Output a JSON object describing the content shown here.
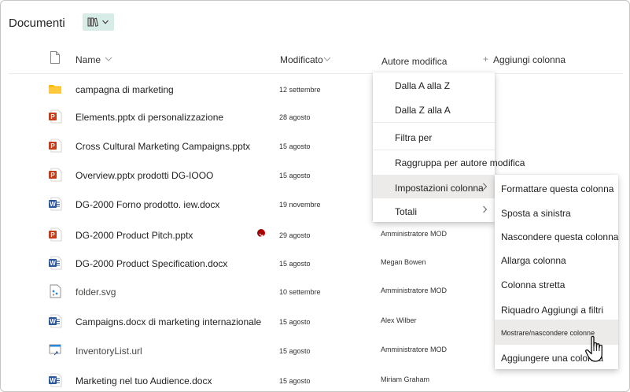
{
  "library": {
    "title": "Documenti",
    "view_icon": "library-icon"
  },
  "columns": {
    "name": "Name",
    "modified": "Modificato",
    "author": "Autore modifica",
    "add_column": "Aggiungi colonna",
    "add_symbol": "+"
  },
  "files": [
    {
      "name": "campagna di marketing",
      "date": "12 settembre",
      "author": "",
      "type": "folder"
    },
    {
      "name": "Elements.pptx di personalizzazione",
      "date": "28 agosto",
      "author": "",
      "type": "pptx"
    },
    {
      "name": "Cross Cultural Marketing Campaigns.pptx",
      "date": "15 agosto",
      "author": "",
      "type": "pptx"
    },
    {
      "name": "Overview.pptx prodotti DG-IOOO",
      "date": "15 agosto",
      "author": "",
      "type": "pptx"
    },
    {
      "name": "DG-2000 Forno prodotto. iew.docx",
      "date": "19 novembre",
      "author": "",
      "type": "docx"
    },
    {
      "name": "DG-2000 Product Pitch.pptx",
      "date": "29 agosto",
      "author": "Amministratore MOD",
      "type": "pptx"
    },
    {
      "name": "DG-2000 Product Specification.docx",
      "date": "15 agosto",
      "author": "Megan Bowen",
      "type": "docx"
    },
    {
      "name": "folder.svg",
      "date": "10 settembre",
      "author": "Amministratore MOD",
      "type": "svg"
    },
    {
      "name": "Campaigns.docx di marketing internazionale",
      "date": "15 agosto",
      "author": "Alex Wilber",
      "type": "docx"
    },
    {
      "name": "InventoryList.url",
      "date": "15 agosto",
      "author": "Amministratore MOD",
      "type": "url"
    },
    {
      "name": "Marketing nel tuo Audience.docx",
      "date": "15 agosto",
      "author": "Miriam Graham",
      "type": "docx"
    }
  ],
  "column_menu": {
    "sort_az": "Dalla A alla Z",
    "sort_za": "Dalla Z alla A",
    "filter": "Filtra per",
    "group": "Raggruppa per autore modifica",
    "settings": "Impostazioni colonna",
    "totals": "Totali"
  },
  "settings_menu": {
    "format": "Formattare questa colonna",
    "move_left": "Sposta a sinistra",
    "hide": "Nascondere questa colonna",
    "widen": "Allarga colonna",
    "narrow": "Colonna stretta",
    "filter_pane": "Riquadro Aggiungi a filtri",
    "show_hide": "Mostrare/nascondere colonne",
    "add_column": "Aggiungere una colonna"
  },
  "colors": {
    "pptx": "#c43e1c",
    "docx": "#2b579a",
    "folder": "#ffb900",
    "view_switch_bg": "#d7ece6",
    "badge": "#a80000"
  }
}
